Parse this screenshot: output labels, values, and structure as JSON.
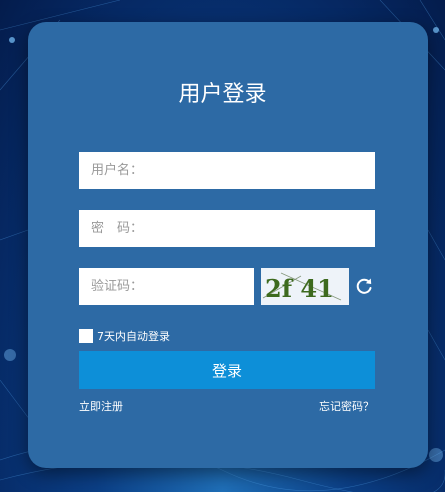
{
  "login": {
    "title": "用户登录",
    "username_placeholder": "用户名：",
    "password_placeholder": "密　码：",
    "captcha_placeholder": "验证码：",
    "captcha_text": "2f 41",
    "remember_label": "7天内自动登录",
    "submit_label": "登录",
    "register_link": "立即注册",
    "forgot_link": "忘记密码？"
  },
  "icons": {
    "refresh": "refresh-icon"
  },
  "colors": {
    "panel": "#2d6aa5",
    "button": "#0d8fd8",
    "background": "#0b3f86"
  }
}
